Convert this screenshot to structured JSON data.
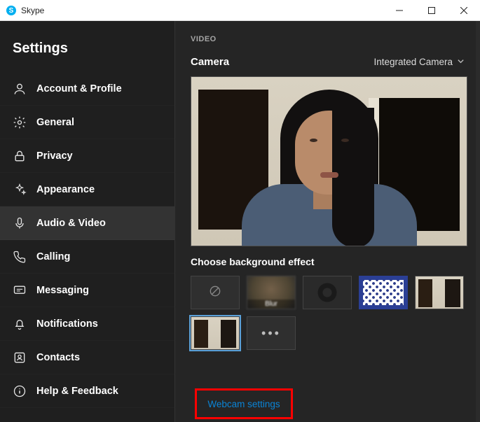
{
  "titlebar": {
    "app_name": "Skype"
  },
  "sidebar": {
    "heading": "Settings",
    "items": [
      {
        "label": "Account & Profile"
      },
      {
        "label": "General"
      },
      {
        "label": "Privacy"
      },
      {
        "label": "Appearance"
      },
      {
        "label": "Audio & Video"
      },
      {
        "label": "Calling"
      },
      {
        "label": "Messaging"
      },
      {
        "label": "Notifications"
      },
      {
        "label": "Contacts"
      },
      {
        "label": "Help & Feedback"
      }
    ],
    "active_index": 4
  },
  "content": {
    "section_label": "VIDEO",
    "camera_label": "Camera",
    "camera_selected": "Integrated Camera",
    "effect_heading": "Choose background effect",
    "effects": {
      "blur_caption": "Blur",
      "more_glyph": "•••"
    },
    "webcam_settings_link": "Webcam settings"
  }
}
